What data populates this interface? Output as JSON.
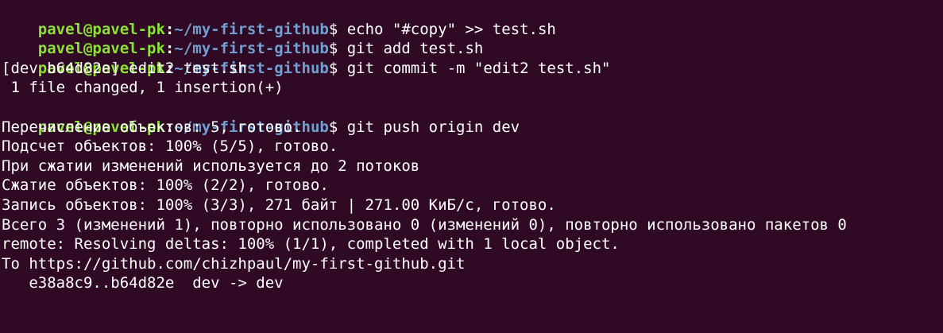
{
  "colors": {
    "background": "#300a24",
    "prompt_user": "#8ae234",
    "prompt_path": "#729fcf",
    "text": "#ffffff"
  },
  "lines": [
    {
      "kind": "prompt",
      "user": "pavel@pavel-pk",
      "sep": ":",
      "path": "~/my-first-github",
      "dollar": "$ ",
      "cmd": "echo \"#copy\" >> test.sh"
    },
    {
      "kind": "prompt",
      "user": "pavel@pavel-pk",
      "sep": ":",
      "path": "~/my-first-github",
      "dollar": "$ ",
      "cmd": "git add test.sh"
    },
    {
      "kind": "prompt",
      "user": "pavel@pavel-pk",
      "sep": ":",
      "path": "~/my-first-github",
      "dollar": "$ ",
      "cmd": "git commit -m \"edit2 test.sh\""
    },
    {
      "kind": "output",
      "text": "[dev b64d82e] edit2 test.sh"
    },
    {
      "kind": "output",
      "text": " 1 file changed, 1 insertion(+)"
    },
    {
      "kind": "prompt",
      "user": "pavel@pavel-pk",
      "sep": ":",
      "path": "~/my-first-github",
      "dollar": "$ ",
      "cmd": "git push origin dev"
    },
    {
      "kind": "output",
      "text": "Перечисление объектов: 5, готово."
    },
    {
      "kind": "output",
      "text": "Подсчет объектов: 100% (5/5), готово."
    },
    {
      "kind": "output",
      "text": "При сжатии изменений используется до 2 потоков"
    },
    {
      "kind": "output",
      "text": "Сжатие объектов: 100% (2/2), готово."
    },
    {
      "kind": "output",
      "text": "Запись объектов: 100% (3/3), 271 байт | 271.00 КиБ/с, готово."
    },
    {
      "kind": "output",
      "text": "Всего 3 (изменений 1), повторно использовано 0 (изменений 0), повторно использовано пакетов 0"
    },
    {
      "kind": "output",
      "text": "remote: Resolving deltas: 100% (1/1), completed with 1 local object."
    },
    {
      "kind": "output",
      "text": "To https://github.com/chizhpaul/my-first-github.git"
    },
    {
      "kind": "output",
      "text": "   e38a8c9..b64d82e  dev -> dev"
    }
  ]
}
